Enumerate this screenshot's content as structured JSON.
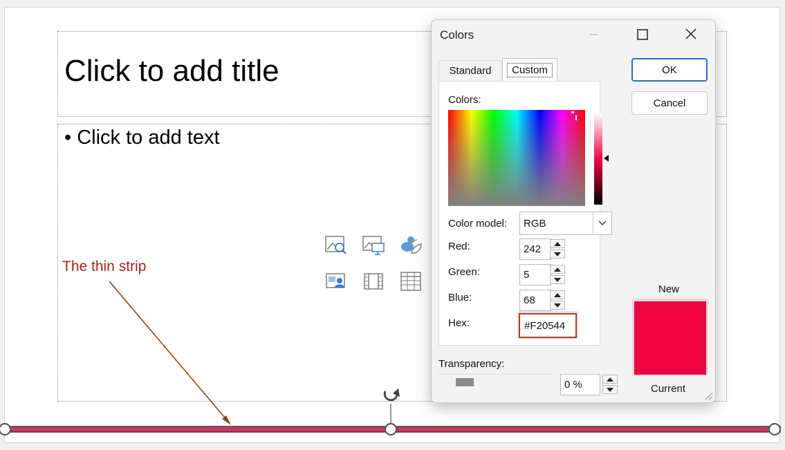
{
  "slide": {
    "title_placeholder": "Click to add title",
    "body_placeholder": "• Click to add text",
    "insert_icons": [
      "stock-images-icon",
      "pictures-icon",
      "icons-icon",
      "cameo-icon",
      "video-icon",
      "table-icon"
    ]
  },
  "annotation": {
    "text": "The thin strip",
    "color": "#a5231f",
    "arrow_color": "#8b4513"
  },
  "strip": {
    "fill_color": "#c8375f",
    "border_color": "#3b3b3b"
  },
  "dialog": {
    "title": "Colors",
    "tabs": [
      "Standard",
      "Custom"
    ],
    "active_tab": "Custom",
    "colors_label": "Colors:",
    "color_model_label": "Color model:",
    "color_model_value": "RGB",
    "red_label": "Red:",
    "red_value": "242",
    "green_label": "Green:",
    "green_value": "5",
    "blue_label": "Blue:",
    "blue_value": "68",
    "hex_label": "Hex:",
    "hex_value": "#F20544",
    "transparency_label": "Transparency:",
    "transparency_value": "0 %",
    "ok_label": "OK",
    "cancel_label": "Cancel",
    "new_label": "New",
    "current_label": "Current",
    "new_color": "#F20544"
  }
}
